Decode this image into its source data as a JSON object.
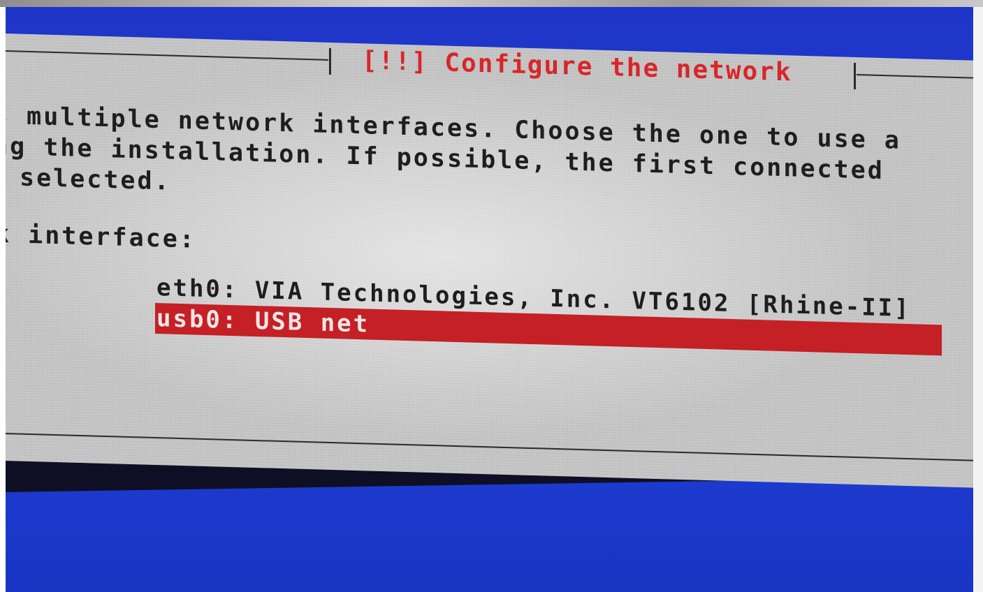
{
  "dialog": {
    "title": "[!!] Configure the network",
    "text_lines": [
      "s multiple network interfaces. Choose the one to use a",
      "ng the installation. If possible, the first connected",
      "selected."
    ],
    "prompt": "k interface:",
    "options": [
      {
        "label": "eth0: VIA Technologies, Inc. VT6102 [Rhine-II]",
        "selected": false
      },
      {
        "label": "usb0: USB net",
        "selected": true
      }
    ]
  },
  "colors": {
    "screen_background": "#1f3fd8",
    "dialog_background": "#c9c9c9",
    "title_text": "#d8262a",
    "selection_highlight": "#c42025"
  }
}
